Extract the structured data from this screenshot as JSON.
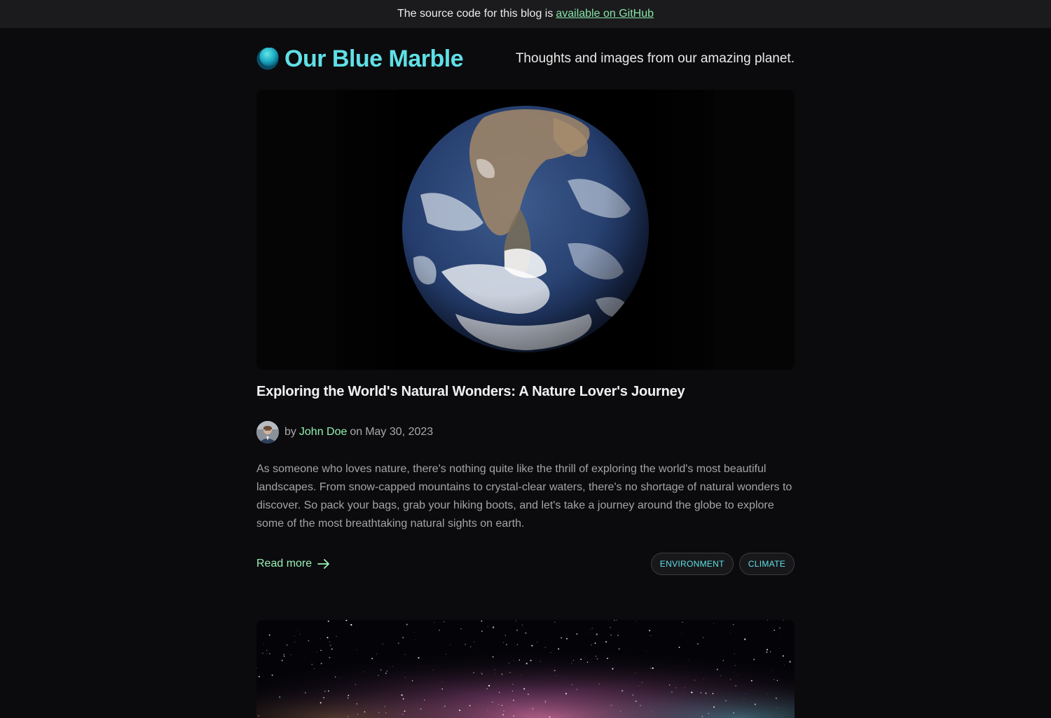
{
  "banner": {
    "text": "The source code for this blog is",
    "link_label": "available on GitHub"
  },
  "site": {
    "name": "Our Blue Marble",
    "tagline": "Thoughts and images from our amazing planet.",
    "brand_color": "#5fe0e6",
    "link_color": "#8ff0b0",
    "logo_icon": "globe-icon"
  },
  "post": {
    "title": "Exploring the World's Natural Wonders: A Nature Lover's Journey",
    "by": "by",
    "author": "John Doe",
    "on": "on",
    "date": "May 30, 2023",
    "excerpt": "As someone who loves nature, there's nothing quite like the thrill of exploring the world's most beautiful landscapes. From snow-capped mountains to crystal-clear waters, there's no shortage of natural wonders to discover. So pack your bags, grab your hiking boots, and let's take a journey around the globe to explore some of the most breathtaking natural sights on earth.",
    "read_more": "Read more",
    "tags": [
      "ENVIRONMENT",
      "CLIMATE"
    ]
  }
}
